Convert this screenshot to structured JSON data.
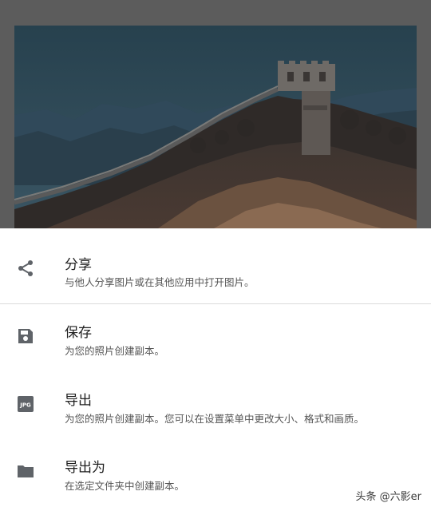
{
  "menu": {
    "items": [
      {
        "id": "share",
        "icon": "share-icon",
        "title": "分享",
        "subtitle": "与他人分享图片或在其他应用中打开图片。"
      },
      {
        "id": "save",
        "icon": "save-icon",
        "title": "保存",
        "subtitle": "为您的照片创建副本。"
      },
      {
        "id": "export",
        "icon": "jpg-icon",
        "icon_text": "JPG",
        "title": "导出",
        "subtitle": "为您的照片创建副本。您可以在设置菜单中更改大小、格式和画质。"
      },
      {
        "id": "export-as",
        "icon": "folder-icon",
        "title": "导出为",
        "subtitle": "在选定文件夹中创建副本。"
      }
    ]
  },
  "watermark": "头条 @六影er",
  "colors": {
    "icon": "#5f6368",
    "title": "#202020",
    "subtitle": "#555555",
    "sheet_background": "#ffffff",
    "scrim": "#5c5c5c"
  }
}
